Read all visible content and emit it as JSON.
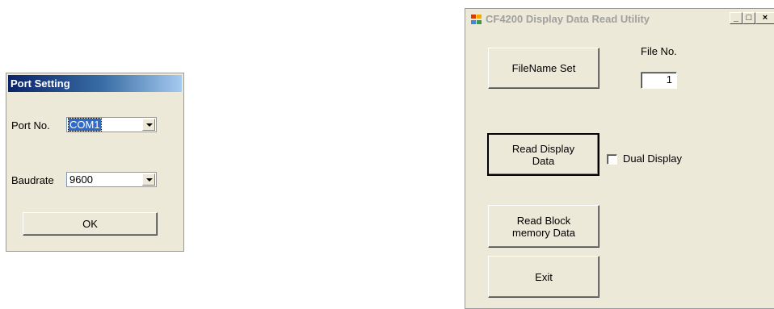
{
  "port_dialog": {
    "title": "Port Setting",
    "port_label": "Port No.",
    "port_value": "COM1",
    "baud_label": "Baudrate",
    "baud_value": "9600",
    "ok_label": "OK"
  },
  "main_window": {
    "title": "CF4200 Display Data Read Utility",
    "controls": {
      "minimize": "_",
      "maximize": "□",
      "close": "×"
    },
    "filename_button": "FileName Set",
    "file_no_label": "File No.",
    "file_no_value": "1",
    "read_display_button": "Read Display\nData",
    "dual_display_label": "Dual Display",
    "dual_display_checked": false,
    "read_block_button": "Read Block\nmemory Data",
    "exit_button": "Exit"
  }
}
